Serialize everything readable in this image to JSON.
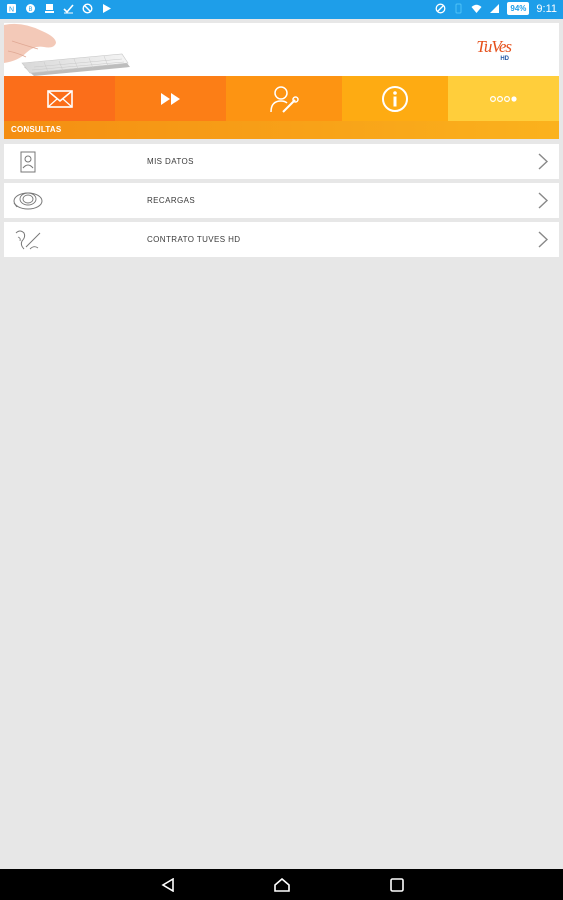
{
  "status_bar": {
    "left_icons": [
      "notification-icon",
      "globe-icon",
      "download-icon",
      "check-icon",
      "blocked-icon",
      "play-store-icon"
    ],
    "battery": "94%",
    "time": "9:11"
  },
  "header": {
    "logo_text": "TuVes",
    "logo_sub": "HD"
  },
  "toolbar": {
    "items": [
      {
        "icon": "mail-icon"
      },
      {
        "icon": "fast-forward-icon"
      },
      {
        "icon": "user-settings-icon"
      },
      {
        "icon": "info-icon"
      },
      {
        "icon": "more-dots-icon"
      }
    ],
    "colors": [
      "#fb6e1a",
      "#fc7e16",
      "#fd9412",
      "#feab12",
      "#ffce3b"
    ]
  },
  "section": {
    "title": "CONSULTAS"
  },
  "list": {
    "items": [
      {
        "label": "MIS DATOS",
        "icon": "id-card-icon"
      },
      {
        "label": "RECARGAS",
        "icon": "recharge-icon"
      },
      {
        "label": "CONTRATO TUVES HD",
        "icon": "contract-signature-icon"
      }
    ]
  },
  "colors": {
    "status_bar": "#1e9ee9",
    "background": "#e7e7e7",
    "accent": "#f48e12"
  }
}
